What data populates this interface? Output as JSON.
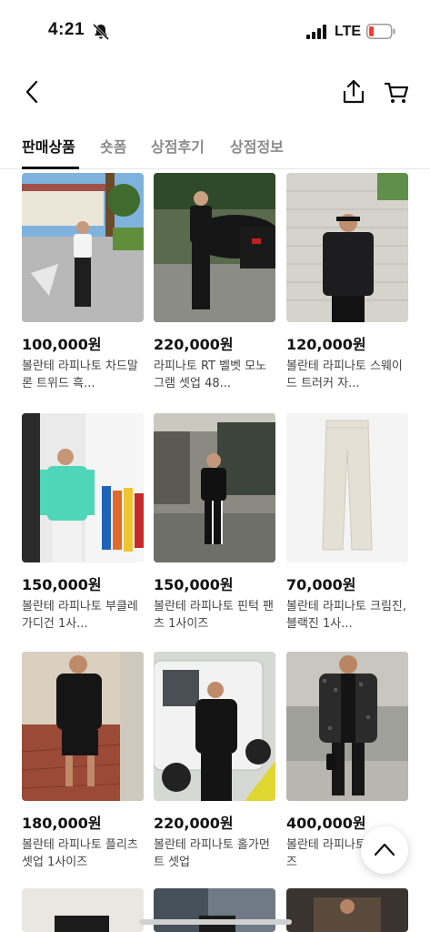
{
  "status_bar": {
    "time": "4:21",
    "network": "LTE",
    "battery_color": "#ff3b30"
  },
  "header": {
    "icons": [
      "back-icon",
      "share-icon",
      "cart-icon"
    ]
  },
  "tabs": [
    {
      "label": "판매상품",
      "active": true
    },
    {
      "label": "숏폼",
      "active": false
    },
    {
      "label": "상점후기",
      "active": false
    },
    {
      "label": "상점정보",
      "active": false
    }
  ],
  "products": [
    {
      "price": "100,000원",
      "title": "볼란테 라피나토 차드말론 트위드 흑..."
    },
    {
      "price": "220,000원",
      "title": "라피나토 RT 벨벳 모노그램 셋업 48..."
    },
    {
      "price": "120,000원",
      "title": "볼란테 라피나토 스웨이드 트러커 자..."
    },
    {
      "price": "150,000원",
      "title": "볼란테 라피나토 부클레 가디건 1사..."
    },
    {
      "price": "150,000원",
      "title": "볼란테 라피나토 핀턱 팬츠 1사이즈"
    },
    {
      "price": "70,000원",
      "title": "볼란테 라피나토 크림진,블랙진 1사..."
    },
    {
      "price": "180,000원",
      "title": "볼란테 라피나토 플리츠 셋업 1사이즈"
    },
    {
      "price": "220,000원",
      "title": "볼란테 라피나토 홀가먼트 셋업"
    },
    {
      "price": "400,000원",
      "title": "볼란테 라피나토 1사이즈"
    }
  ]
}
